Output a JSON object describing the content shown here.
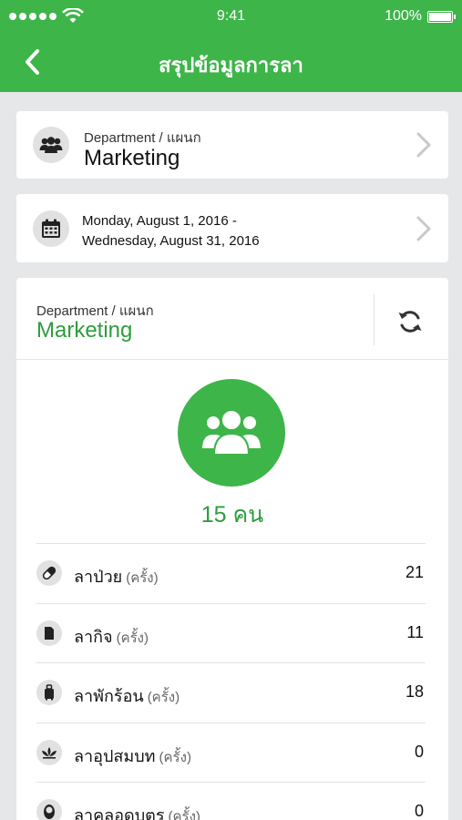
{
  "status_bar": {
    "time": "9:41",
    "battery_text": "100%",
    "signal_icon": "signal-dots-icon",
    "wifi_icon": "wifi-icon",
    "battery_icon": "battery-icon"
  },
  "nav": {
    "title": "สรุปข้อมูลการลา",
    "back_icon": "chevron-left-icon"
  },
  "department_selector": {
    "label": "Department / แผนก",
    "value": "Marketing",
    "icon": "group-icon"
  },
  "date_selector": {
    "line1": "Monday, August 1, 2016 -",
    "line2": "Wednesday, August 31, 2016",
    "icon": "calendar-icon"
  },
  "summary": {
    "label": "Department / แผนก",
    "department": "Marketing",
    "people_count": "15 คน",
    "refresh_icon": "refresh-icon",
    "avatar_icon": "group-icon"
  },
  "leave_types": [
    {
      "label": "ลาป่วย",
      "unit": "(ครั้ง)",
      "value": "21",
      "icon": "pill-icon"
    },
    {
      "label": "ลากิจ",
      "unit": "(ครั้ง)",
      "value": "11",
      "icon": "document-icon"
    },
    {
      "label": "ลาพักร้อน",
      "unit": "(ครั้ง)",
      "value": "18",
      "icon": "luggage-icon"
    },
    {
      "label": "ลาอุปสมบท",
      "unit": "(ครั้ง)",
      "value": "0",
      "icon": "lotus-icon"
    },
    {
      "label": "ลาคลอดบุตร",
      "unit": "(ครั้ง)",
      "value": "0",
      "icon": "baby-icon"
    }
  ],
  "colors": {
    "primary_green": "#3db549",
    "text_green": "#2e9c3e",
    "background": "#e5e7e8"
  }
}
